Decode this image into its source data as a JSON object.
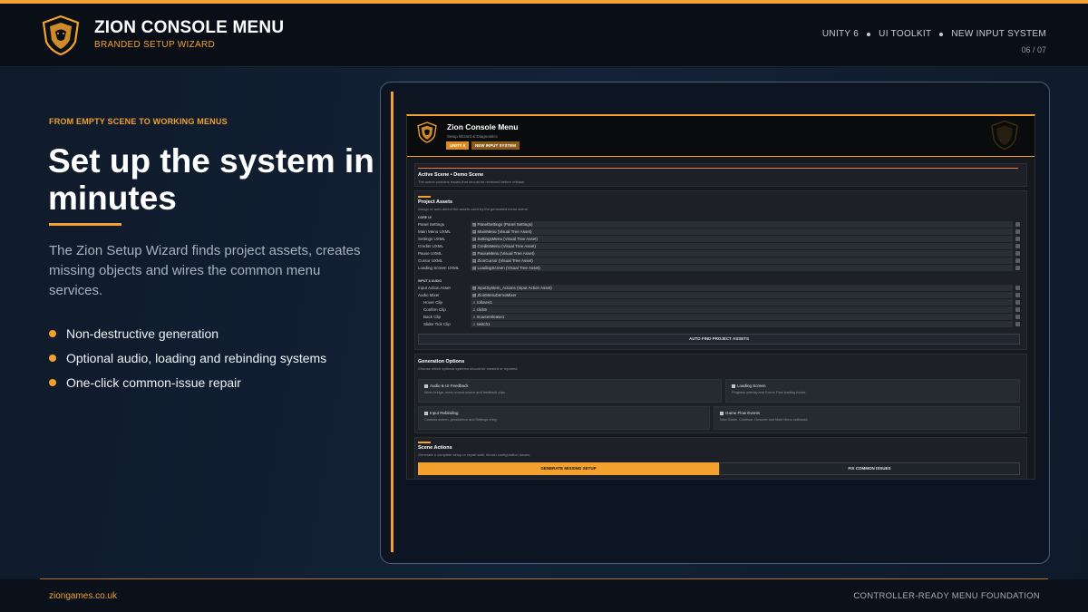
{
  "header": {
    "title": "ZION CONSOLE MENU",
    "subtitle": "BRANDED SETUP WIZARD",
    "tags": [
      "UNITY 6",
      "UI TOOLKIT",
      "NEW INPUT SYSTEM"
    ],
    "page": "06 / 07"
  },
  "hero": {
    "eyebrow": "FROM EMPTY SCENE TO WORKING MENUS",
    "headline": "Set up the system in minutes",
    "description": "The Zion Setup Wizard finds project assets, creates missing objects and wires the common menu services.",
    "bullets": [
      "Non-destructive generation",
      "Optional audio, loading and rebinding systems",
      "One-click common-issue repair"
    ]
  },
  "app": {
    "title": "Zion Console Menu",
    "subtitle": "Setup Wizard & Diagnostics",
    "pills": [
      "UNITY 6",
      "NEW INPUT SYSTEM"
    ],
    "scene": {
      "title": "Active Scene  •  Demo Scene",
      "subtitle": "The scene contains issues that should be reviewed before release."
    },
    "assets": {
      "title": "Project Assets",
      "subtitle": "Assign or auto-detect the assets used by the generated menu scene.",
      "core_label": "CORE UI",
      "core_rows": [
        {
          "label": "Panel Settings",
          "value": "▧ PanelSettings (Panel Settings)"
        },
        {
          "label": "Main Menu UXML",
          "value": "▤ MainMenu (Visual Tree Asset)"
        },
        {
          "label": "Settings UXML",
          "value": "▤ SettingsMenu (Visual Tree Asset)"
        },
        {
          "label": "Credits UXML",
          "value": "▤ CreditsMenu (Visual Tree Asset)"
        },
        {
          "label": "Pause UXML",
          "value": "▤ PauseMenu (Visual Tree Asset)"
        },
        {
          "label": "Cursor UXML",
          "value": "▤ ZionCursor (Visual Tree Asset)"
        },
        {
          "label": "Loading Screen UXML",
          "value": "▤ LoadingScreen (Visual Tree Asset)"
        }
      ],
      "input_label": "INPUT & AUDIO",
      "input_rows": [
        {
          "label": "Input Action Asset",
          "value": "▧ InputSystem_Actions (Input Action Asset)",
          "indent": false
        },
        {
          "label": "Audio Mixer",
          "value": "▧ ZionMenuDemoMixer",
          "indent": false
        },
        {
          "label": "Hover Clip",
          "value": "♫ rollover1",
          "indent": true
        },
        {
          "label": "Confirm Clip",
          "value": "♫ click5",
          "indent": true
        },
        {
          "label": "Back Clip",
          "value": "♫ mouserelease1",
          "indent": true
        },
        {
          "label": "Slider Tick Clip",
          "value": "♫ switch1",
          "indent": true
        }
      ],
      "auto_button": "AUTO FIND PROJECT ASSETS"
    },
    "generation": {
      "title": "Generation Options",
      "subtitle": "Choose which optional systems should be created or repaired.",
      "options": [
        {
          "title": "Audio & UI Feedback",
          "desc": "Mixer bridge, menu sound source and feedback clips."
        },
        {
          "title": "Loading Screen",
          "desc": "Progress overlay and Scene Flow loading hooks."
        },
        {
          "title": "Input Rebinding",
          "desc": "Controls screen, persistence and Settings entry."
        },
        {
          "title": "Game Flow Events",
          "desc": "New Game, Continue, Resume and Main Menu callbacks."
        }
      ]
    },
    "actions": {
      "title": "Scene Actions",
      "subtitle": "Generate a complete setup or repair safe, known configuration issues.",
      "generate": "GENERATE MISSING SETUP",
      "fix": "FIX COMMON ISSUES"
    }
  },
  "footer": {
    "left": "ziongames.co.uk",
    "right": "CONTROLLER-READY MENU FOUNDATION"
  },
  "colors": {
    "accent": "#f2a12e",
    "background": "#0f1825",
    "warning": "#f07a3a"
  }
}
